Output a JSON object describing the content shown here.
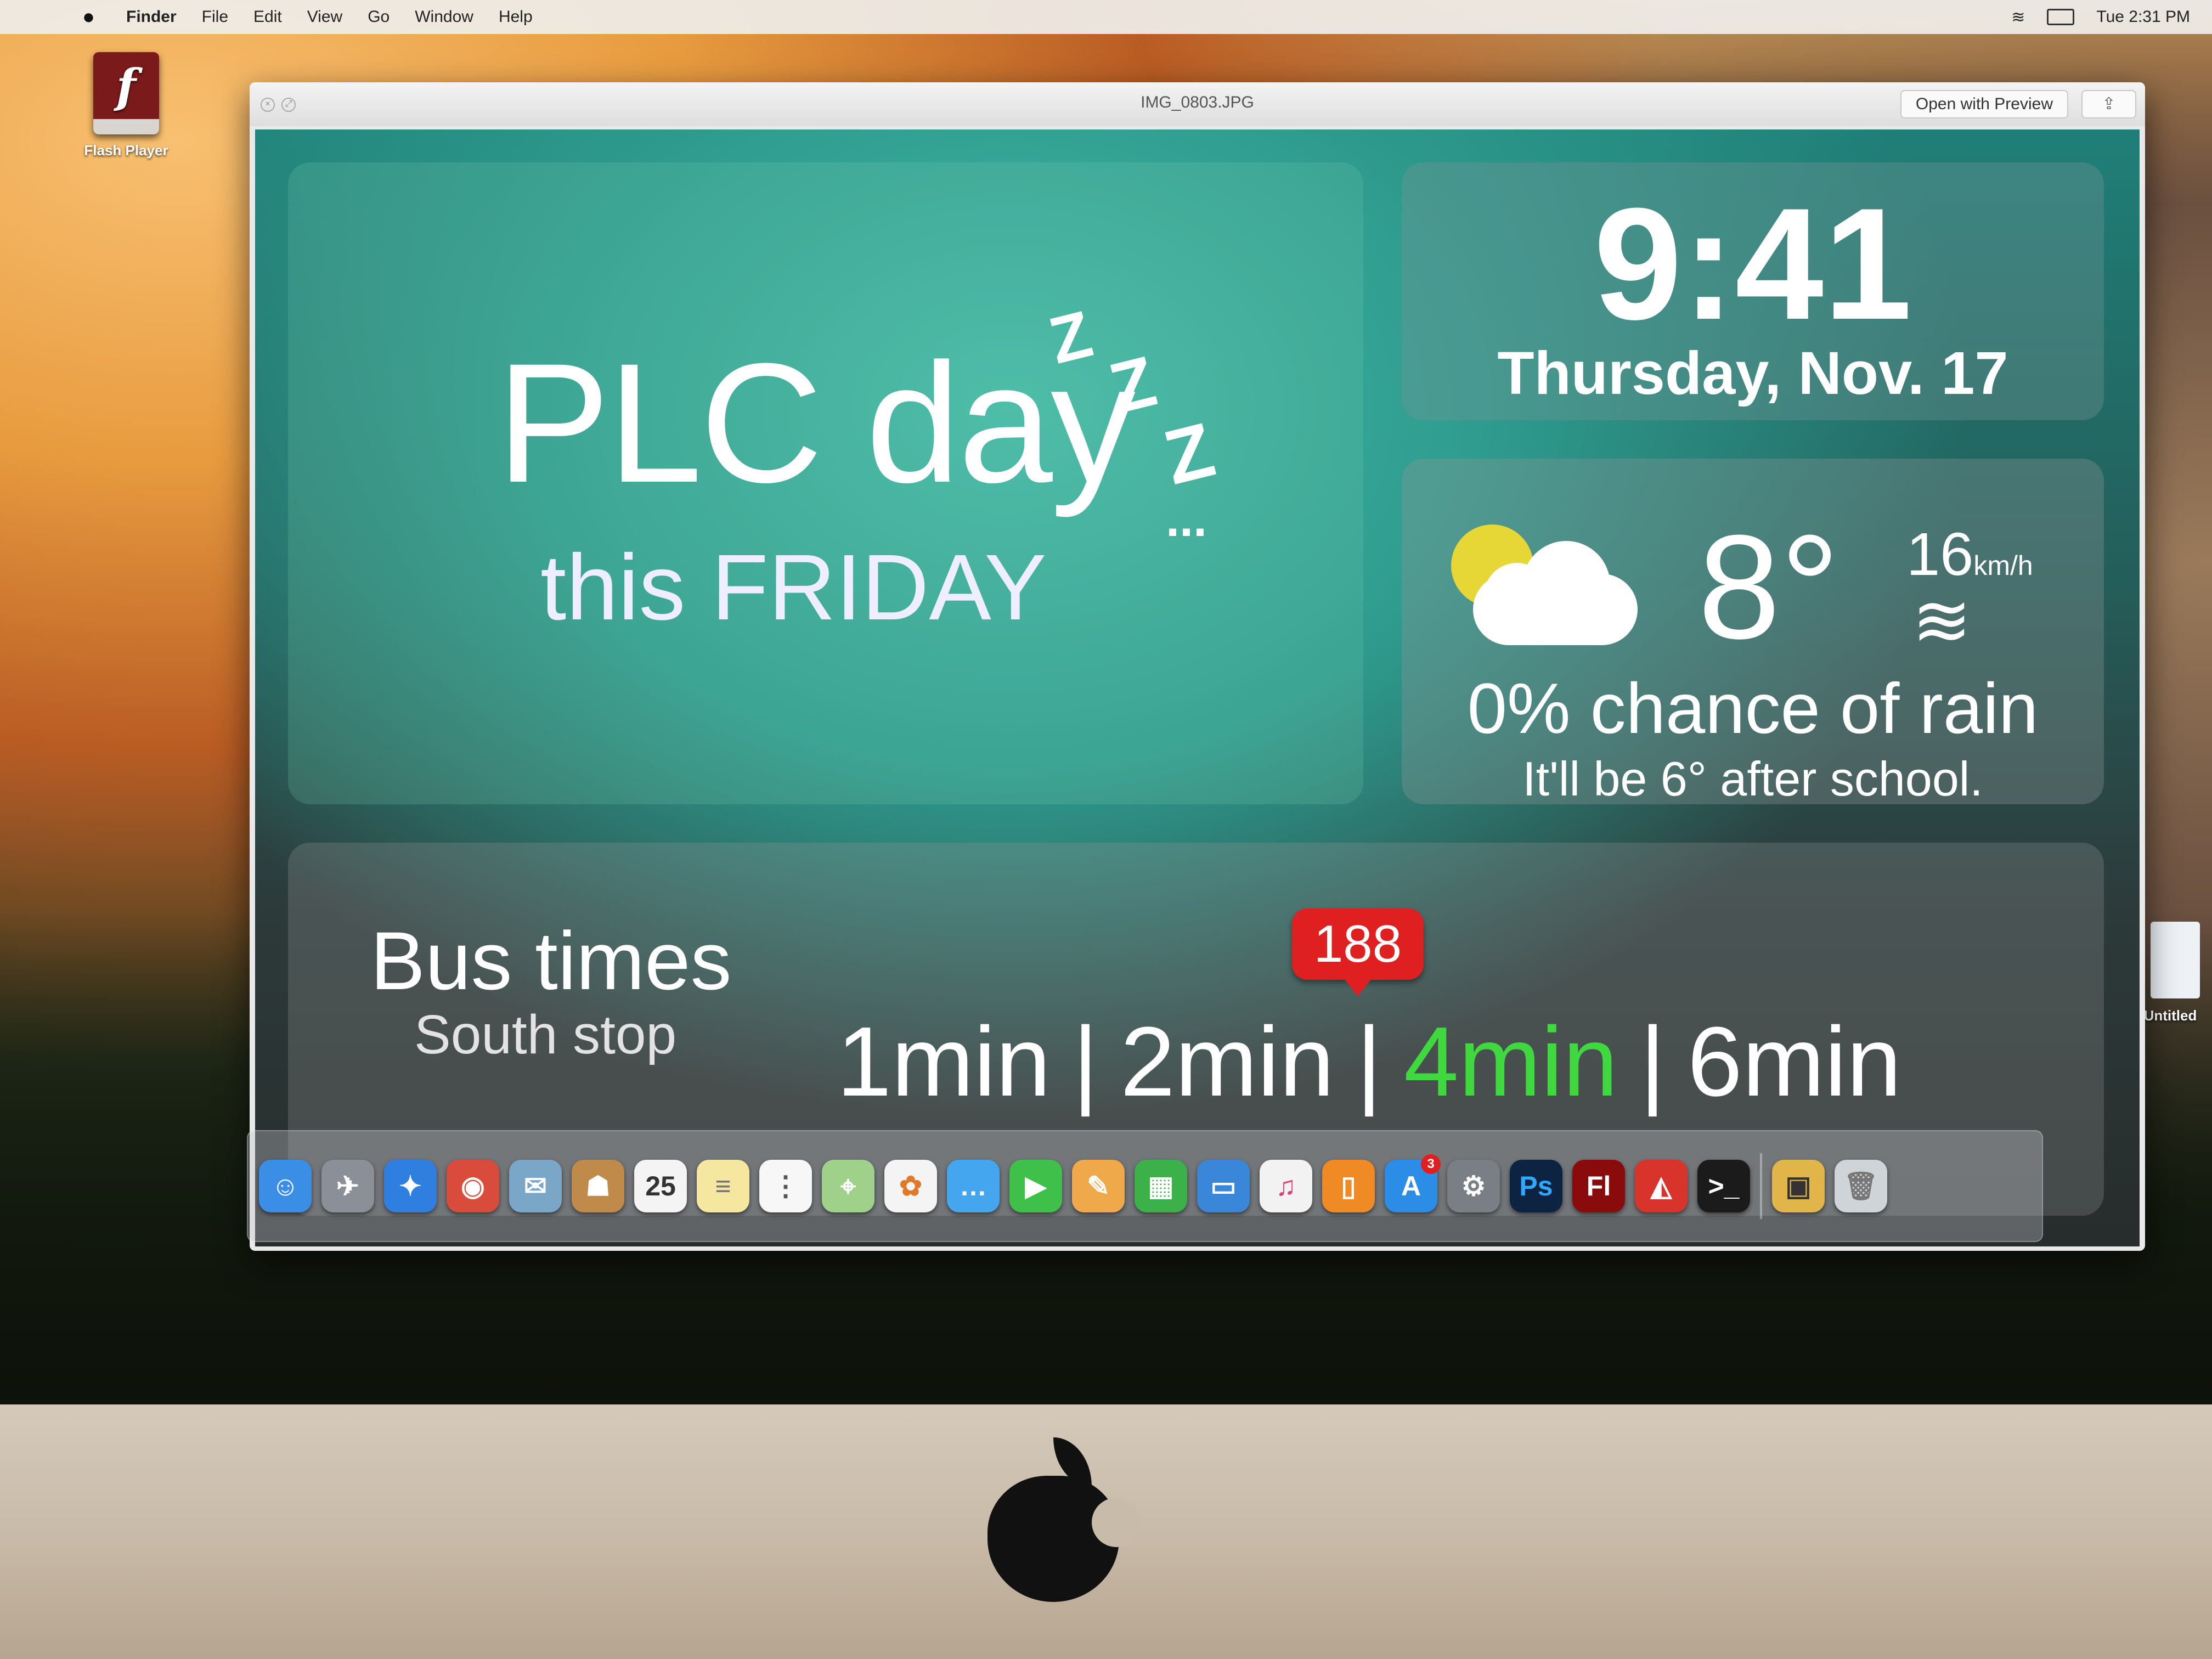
{
  "menubar": {
    "app": "Finder",
    "items": [
      "File",
      "Edit",
      "View",
      "Go",
      "Window",
      "Help"
    ],
    "clock": "Tue 2:31 PM"
  },
  "desktop": {
    "flash_player_label": "Flash Player",
    "untitled_label": "Untitled"
  },
  "window": {
    "title": "IMG_0803.JPG",
    "open_with_preview": "Open with Preview"
  },
  "slide": {
    "plc": {
      "title": "PLC day",
      "subtitle": "this FRIDAY",
      "z1": "Z",
      "z2": "Z",
      "z3": "Z",
      "dots": "..."
    },
    "clock": {
      "time": "9:41",
      "date": "Thursday, Nov. 17"
    },
    "weather": {
      "icon": "partly-cloudy-icon",
      "temperature": "8°",
      "wind_speed": "16",
      "wind_unit": "km/h",
      "wind_icon": "wind-icon",
      "rain": "0% chance of rain",
      "after_school": "It'll be 6° after school."
    },
    "bus": {
      "title": "Bus times",
      "stop": "South stop",
      "times": [
        "1min",
        "2min",
        "4min",
        "6min"
      ],
      "separator": "|",
      "badge": "188",
      "highlight_color": "#3fd93f"
    }
  },
  "dock": {
    "items": [
      {
        "name": "finder-icon",
        "color": "#3a8ee6",
        "glyph": "☺"
      },
      {
        "name": "launchpad-icon",
        "color": "#8a8f98",
        "glyph": "✈"
      },
      {
        "name": "safari-icon",
        "color": "#2f7fe0",
        "glyph": "✦"
      },
      {
        "name": "chrome-icon",
        "color": "#d94b3a",
        "glyph": "◉"
      },
      {
        "name": "mail-icon",
        "color": "#7aa6c8",
        "glyph": "✉"
      },
      {
        "name": "contacts-icon",
        "color": "#c08a4a",
        "glyph": "☗"
      },
      {
        "name": "calendar-icon",
        "color": "#f4f4f4",
        "glyph": "25",
        "text": "#333"
      },
      {
        "name": "notes-icon",
        "color": "#f5e7a0",
        "glyph": "≡",
        "text": "#777"
      },
      {
        "name": "reminders-icon",
        "color": "#f7f7f7",
        "glyph": "⋮",
        "text": "#555"
      },
      {
        "name": "maps-icon",
        "color": "#9fd18a",
        "glyph": "⌖"
      },
      {
        "name": "photos-icon",
        "color": "#f4f4f4",
        "glyph": "✿",
        "text": "#e07a2a"
      },
      {
        "name": "messages-icon",
        "color": "#45a6f0",
        "glyph": "…"
      },
      {
        "name": "facetime-icon",
        "color": "#3fc04a",
        "glyph": "▶"
      },
      {
        "name": "pages-icon",
        "color": "#f0a94a",
        "glyph": "✎"
      },
      {
        "name": "numbers-icon",
        "color": "#3cb14a",
        "glyph": "▦"
      },
      {
        "name": "keynote-icon",
        "color": "#3a86d8",
        "glyph": "▭"
      },
      {
        "name": "itunes-icon",
        "color": "#f2f2f2",
        "glyph": "♫",
        "text": "#e0407a"
      },
      {
        "name": "ibooks-icon",
        "color": "#f08a24",
        "glyph": "▯"
      },
      {
        "name": "app-store-icon",
        "color": "#2c8de6",
        "glyph": "A",
        "badge": "3"
      },
      {
        "name": "system-preferences-icon",
        "color": "#7a7f86",
        "glyph": "⚙"
      },
      {
        "name": "photoshop-icon",
        "color": "#0c2341",
        "glyph": "Ps",
        "text": "#31a8ff"
      },
      {
        "name": "flash-icon",
        "color": "#8a0b0b",
        "glyph": "Fl"
      },
      {
        "name": "sketchup-icon",
        "color": "#d9342b",
        "glyph": "◭"
      },
      {
        "name": "terminal-icon",
        "color": "#1b1b1b",
        "glyph": ">_"
      },
      {
        "name": "preview-icon",
        "color": "#e2b54a",
        "glyph": "▣",
        "text": "#333"
      },
      {
        "name": "trash-icon",
        "color": "#cfd4d8",
        "glyph": "🗑",
        "text": "#777"
      }
    ]
  }
}
